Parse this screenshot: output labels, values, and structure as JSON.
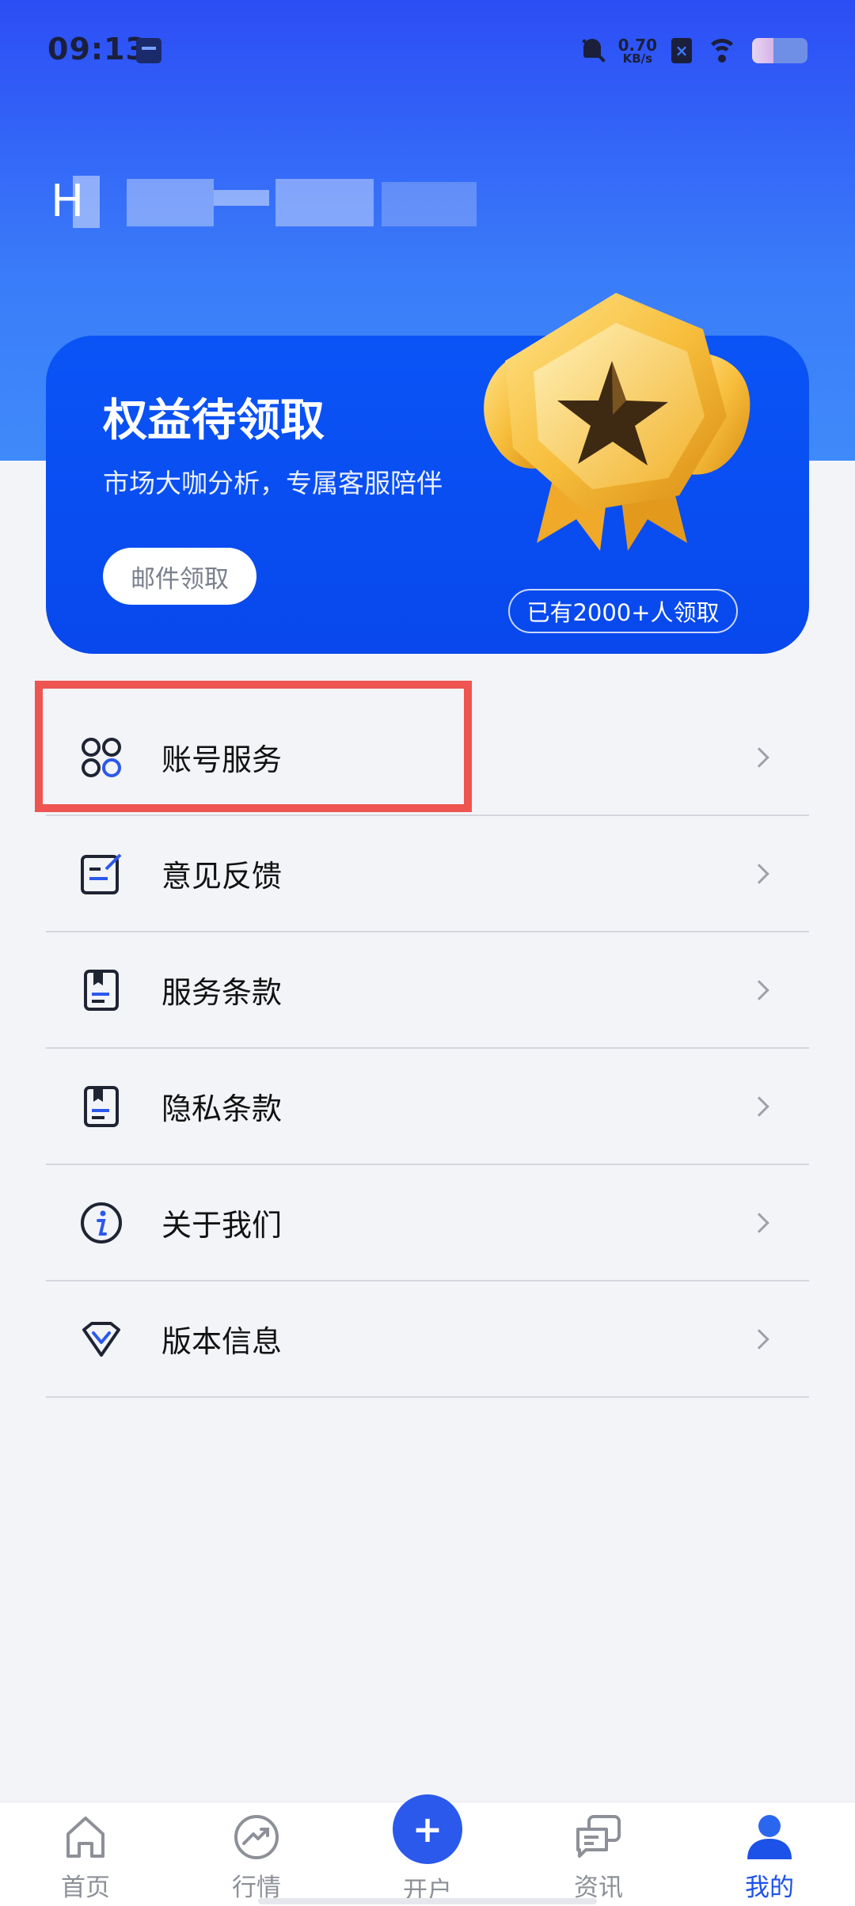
{
  "status_bar": {
    "time": "09:13",
    "net_speed_value": "0.70",
    "net_speed_unit": "KB/s",
    "battery_level": 0.38
  },
  "user": {
    "name_visible": "H"
  },
  "benefit": {
    "title": "权益待领取",
    "subtitle": "市场大咖分析，专属客服陪伴",
    "claim_button": "邮件领取",
    "claim_count": "已有2000+人领取"
  },
  "menu": {
    "items": [
      {
        "label": "账号服务",
        "icon": "account-service-icon"
      },
      {
        "label": "意见反馈",
        "icon": "feedback-icon"
      },
      {
        "label": "服务条款",
        "icon": "terms-icon"
      },
      {
        "label": "隐私条款",
        "icon": "privacy-icon"
      },
      {
        "label": "关于我们",
        "icon": "info-icon"
      },
      {
        "label": "版本信息",
        "icon": "version-icon"
      }
    ]
  },
  "bottom_nav": {
    "items": [
      {
        "label": "首页",
        "icon": "home-icon"
      },
      {
        "label": "行情",
        "icon": "market-icon"
      },
      {
        "label": "开户",
        "icon": "plus-icon"
      },
      {
        "label": "资讯",
        "icon": "news-icon"
      },
      {
        "label": "我的",
        "icon": "user-icon"
      }
    ],
    "active": "我的",
    "open_symbol": "+"
  },
  "colors": {
    "brand_blue": "#0A54F6",
    "active_nav": "#1D52E8",
    "highlight": "#EE5450"
  }
}
